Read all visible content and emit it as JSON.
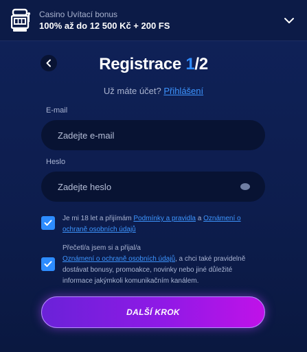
{
  "bonus": {
    "caption": "Casino Uvítací bonus",
    "title": "100% až do 12 500 Kč + 200 FS",
    "icon": "slot-machine-icon",
    "toggle_icon": "chevron-down-icon"
  },
  "form": {
    "title_text": "Registrace ",
    "step_current": "1",
    "step_total": "/2",
    "login_prompt": "Už máte účet?",
    "login_link": "Přihlášení",
    "email_label": "E-mail",
    "email_placeholder": "Zadejte e-mail",
    "email_value": "",
    "password_label": "Heslo",
    "password_placeholder": "Zadejte heslo",
    "password_value": ""
  },
  "consents": [
    {
      "checked": true,
      "text_before": "Je mi 18 let a přijímám ",
      "link1": "Podmínky a pravidla",
      "text_middle": " a ",
      "link2": "Oznámení o ochraně osobních údajů"
    },
    {
      "checked": true,
      "text_before": "Přečetl/a jsem si a přijal/a ",
      "link1": "Oznámení o ochraně osobních údajů",
      "text_after": ", a chci také pravidelně dostávat bonusy, promoakce, novinky nebo jiné důležité informace jakýmkoli komunikačním kanálem."
    }
  ],
  "next_button": "DALŠÍ KROK",
  "colors": {
    "background": "#0b1a44",
    "accent_blue": "#2f8bff",
    "link": "#3d95ff",
    "checkbox": "#2d8cff",
    "button_gradient_start": "#6a22d8",
    "button_gradient_end": "#c012e8"
  }
}
